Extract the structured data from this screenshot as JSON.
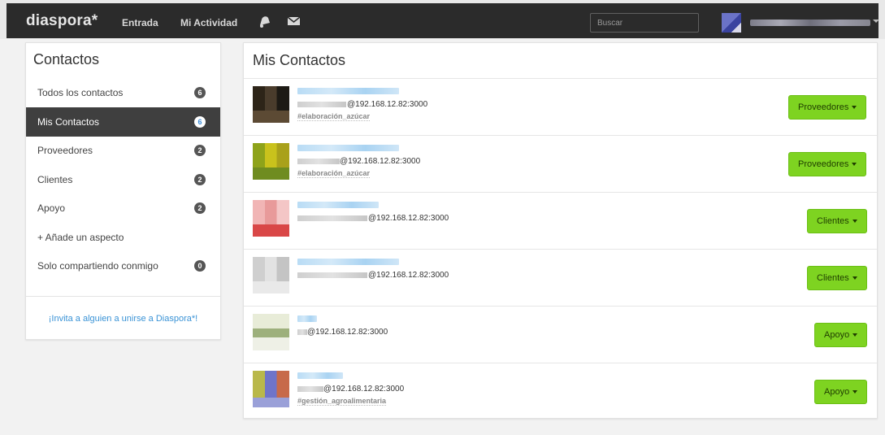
{
  "header": {
    "brand": "diaspora*",
    "nav": [
      "Entrada",
      "Mi Actividad"
    ],
    "search_placeholder": "Buscar"
  },
  "sidebar": {
    "title": "Contactos",
    "items": [
      {
        "label": "Todos los contactos",
        "count": "6"
      },
      {
        "label": "Mis Contactos",
        "count": "6",
        "active": true
      },
      {
        "label": "Proveedores",
        "count": "2"
      },
      {
        "label": "Clientes",
        "count": "2"
      },
      {
        "label": "Apoyo",
        "count": "2"
      },
      {
        "label": "+ Añade un aspecto"
      },
      {
        "label": "Solo compartiendo conmigo",
        "count": "0"
      }
    ],
    "invite": "¡Invita a alguien a unirse a Diaspora*!"
  },
  "main": {
    "title": "Mis Contactos",
    "contacts": [
      {
        "host": "@192.168.12.82:3000",
        "tag": "#elaboración_azúcar",
        "aspect": "Proveedores"
      },
      {
        "host": "@192.168.12.82:3000",
        "tag": "#elaboración_azúcar",
        "aspect": "Proveedores"
      },
      {
        "host": "@192.168.12.82:3000",
        "tag": "",
        "aspect": "Clientes"
      },
      {
        "host": "@192.168.12.82:3000",
        "tag": "",
        "aspect": "Clientes"
      },
      {
        "host": "@192.168.12.82:3000",
        "tag": "",
        "aspect": "Apoyo"
      },
      {
        "host": "@192.168.12.82:3000",
        "tag": "#gestión_agroalimentaria",
        "aspect": "Apoyo"
      }
    ]
  },
  "colors": {
    "accent_green": "#7ed321",
    "header_bg": "#2b2b2b",
    "link_blue": "#3a93d6"
  },
  "icons": [
    "bell-icon",
    "mail-icon",
    "chevron-down-icon"
  ]
}
